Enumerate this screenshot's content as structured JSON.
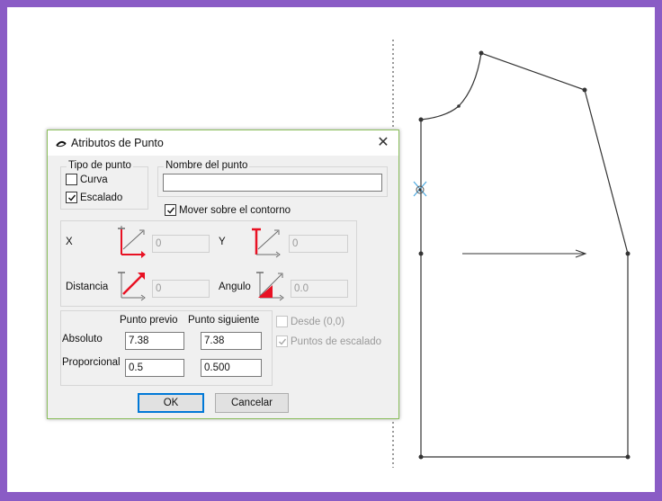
{
  "dialog": {
    "title": "Atributos de Punto",
    "close_glyph": "✕",
    "tipo_de_punto": {
      "legend": "Tipo de punto",
      "curva": {
        "label": "Curva",
        "checked": false
      },
      "escalado": {
        "label": "Escalado",
        "checked": true
      }
    },
    "nombre_del_punto": {
      "legend": "Nombre del punto",
      "value": ""
    },
    "mover_sobre_contorno": {
      "label": "Mover sobre el contorno",
      "checked": true
    },
    "x": {
      "label": "X",
      "value": "0"
    },
    "y": {
      "label": "Y",
      "value": "0"
    },
    "distancia": {
      "label": "Distancia",
      "value": "0"
    },
    "angulo": {
      "label": "Angulo",
      "value": "0.0"
    },
    "columns": {
      "punto_previo": "Punto previo",
      "punto_siguiente": "Punto siguiente"
    },
    "absoluto": {
      "label": "Absoluto",
      "previo": "7.38",
      "siguiente": "7.38"
    },
    "proporcional": {
      "label": "Proporcional",
      "previo": "0.5",
      "siguiente": "0.500"
    },
    "desde": {
      "label": "Desde (0,0)",
      "checked": false
    },
    "puntos_de_escalado": {
      "label": "Puntos de escalado",
      "checked": true
    },
    "ok_label": "OK",
    "cancel_label": "Cancelar"
  },
  "colors": {
    "frame": "#8a5cc5",
    "dialog_border": "#8cbf5e",
    "icon_red": "#e81123",
    "icon_gray": "#6d6d6d",
    "selected_point": "#4aa8e0"
  }
}
